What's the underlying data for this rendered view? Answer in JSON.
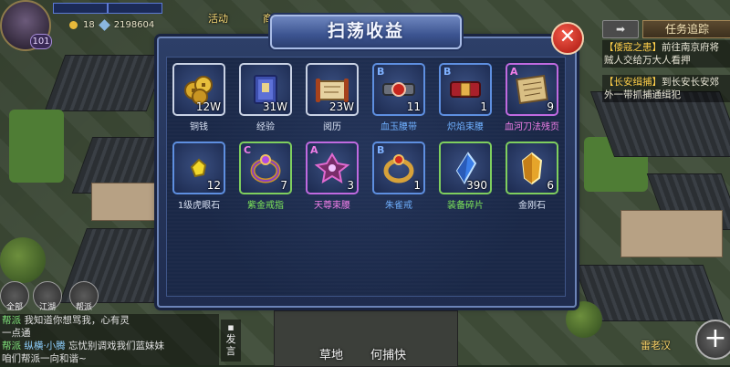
{
  "hud": {
    "level": "101",
    "gold": "18",
    "gems": "2198604",
    "activity_label": "活动",
    "shop_label": "商"
  },
  "quest": {
    "button_label": "",
    "title": "任务追踪",
    "items": [
      {
        "tag": "【倭寇之患】",
        "text": "前往南京府将贼人交给万大人看押"
      },
      {
        "tag": "【长安缉捕】",
        "text": "到长安长安郊外一带抓捕通缉犯"
      }
    ]
  },
  "chat": {
    "lines": [
      {
        "channel": "帮派",
        "name": "",
        "text": "我知道你想骂我，心有灵"
      },
      {
        "channel": "",
        "name": "",
        "text": "一点通"
      },
      {
        "channel": "帮派",
        "name": "纵横·小腾",
        "text": "忘忧别调戏我们蓝妹妹"
      },
      {
        "channel": "",
        "name": "",
        "text": "咱们帮派一向和谐~"
      }
    ],
    "voice_label": "发言",
    "quick_buttons": [
      "全部",
      "江湖",
      "帮派"
    ]
  },
  "bottom": {
    "npc_actions": [
      "草地",
      "何捕快"
    ],
    "npc_name": "雷老汉",
    "plus_label": "+"
  },
  "modal": {
    "title": "扫荡收益",
    "close_label": "✕",
    "items": [
      {
        "icon": "copper-coins-icon",
        "quality_tag": "",
        "count": "12W",
        "name": "铜钱",
        "name_color": "white",
        "border": "white"
      },
      {
        "icon": "experience-book-icon",
        "quality_tag": "",
        "count": "31W",
        "name": "经验",
        "name_color": "white",
        "border": "white"
      },
      {
        "icon": "scroll-icon",
        "quality_tag": "",
        "count": "23W",
        "name": "阅历",
        "name_color": "white",
        "border": "white"
      },
      {
        "icon": "jade-belt-icon",
        "quality_tag": "B",
        "count": "11",
        "name": "血玉腰带",
        "name_color": "blue",
        "border": "blue"
      },
      {
        "icon": "flame-belt-icon",
        "quality_tag": "B",
        "count": "1",
        "name": "炽焰束腰",
        "name_color": "blue",
        "border": "blue"
      },
      {
        "icon": "blade-manual-icon",
        "quality_tag": "A",
        "count": "9",
        "name": "血河刀法残页",
        "name_color": "purple",
        "border": "purple"
      },
      {
        "icon": "tiger-eye-stone-icon",
        "quality_tag": "",
        "count": "12",
        "name": "1级虎眼石",
        "name_color": "white",
        "border": "blue"
      },
      {
        "icon": "purple-gold-ring-icon",
        "quality_tag": "C",
        "count": "7",
        "name": "紫金戒指",
        "name_color": "green",
        "border": "green"
      },
      {
        "icon": "heavenly-belt-icon",
        "quality_tag": "A",
        "count": "3",
        "name": "天尊束腰",
        "name_color": "purple",
        "border": "purple"
      },
      {
        "icon": "vermilion-ring-icon",
        "quality_tag": "B",
        "count": "1",
        "name": "朱雀戒",
        "name_color": "blue",
        "border": "blue"
      },
      {
        "icon": "equipment-shard-icon",
        "quality_tag": "",
        "count": "390",
        "name": "装备碎片",
        "name_color": "green",
        "border": "green"
      },
      {
        "icon": "vajra-stone-icon",
        "quality_tag": "",
        "count": "6",
        "name": "金刚石",
        "name_color": "white",
        "border": "green"
      }
    ]
  }
}
